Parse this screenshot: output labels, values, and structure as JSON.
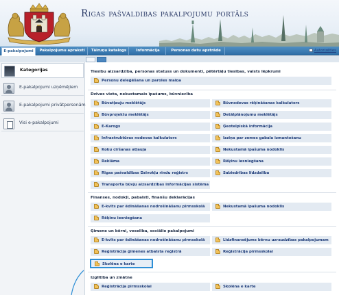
{
  "header": {
    "title": "Rigas pašvaldibas pakalpojumu portāls"
  },
  "nav": {
    "tabs": [
      {
        "label": "E-pakalpojumi"
      },
      {
        "label": "Pakalpojumu apraksti"
      },
      {
        "label": "Tālruņu katalogs"
      },
      {
        "label": "Informācija"
      },
      {
        "label": "Personas datu apstrāde"
      }
    ],
    "auth_label": "Autorizēties"
  },
  "sidebar": {
    "items": [
      {
        "label": "Kategorijas"
      },
      {
        "label": "E-pakalpojumi uzņēmējiem"
      },
      {
        "label": "E-pakalpojumi privātpersonām"
      },
      {
        "label": "Visi e-pakalpojumi"
      }
    ]
  },
  "sections": [
    {
      "title": "Tiesību aizsardzība, personas statuss un dokumenti, pētērtāļu tiesības, valsts lēpkrumi",
      "items": [
        "Personu deleģēšana un paroles maiņa"
      ]
    },
    {
      "title": "Dzīves vieta, nekustamais īpašums, būvniecība",
      "items": [
        "Būvatļauju meklētājs",
        "Būvnodevas rēķināšanas kalkulators",
        "Būvprojektu meklētājs",
        "Detālplānojumu meklētājs",
        "E-Karogs",
        "Ģeotelpiskā informācija",
        "Infrastruktūras nodevas kalkulators",
        "Izziņa par zemes gabala izmantošanu",
        "Koku ciršanas atļauja",
        "Nekustamā īpašuma nodoklis",
        "Reklāma",
        "Rēķinu iesniegšana",
        "Rīgas pašvaldības Dzīvokļu rindu reģistrs",
        "Sabiedrības līdzdalība",
        "Transporta būvju aizsardzības informācijas sistēma"
      ]
    },
    {
      "title": "Finanses, nodokļi, pabalsti, finanšu deklarācijas",
      "items": [
        "E-kvīts par ēdināšanas nodrošināšanu pirmsskolā",
        "Nekustamā īpašuma nodoklis",
        "Rēķinu iesniegšana"
      ]
    },
    {
      "title": "Ģimene un bērni, veselība, sociālie pakalpojumi",
      "items": [
        "E-kvīts par ēdināšanas nodrošināšanu pirmsskolā",
        "Līdzfinansējums bērnu uzraudzības pakalpojumam",
        "Reģistrācija ģimenes atbalsta reģistrā",
        "Reģistrācija pirmsskolai",
        "Skolēna e karte"
      ]
    },
    {
      "title": "Izglītība un zinātne",
      "items": [
        "Reģistrācija pirmsskolai",
        "Skolēna e karte"
      ]
    }
  ],
  "colors": {
    "nav_blue": "#3a78b0",
    "highlight": "#2e8fd6",
    "tile_bg": "#e3eaf2",
    "link_text": "#1f3d7a"
  }
}
